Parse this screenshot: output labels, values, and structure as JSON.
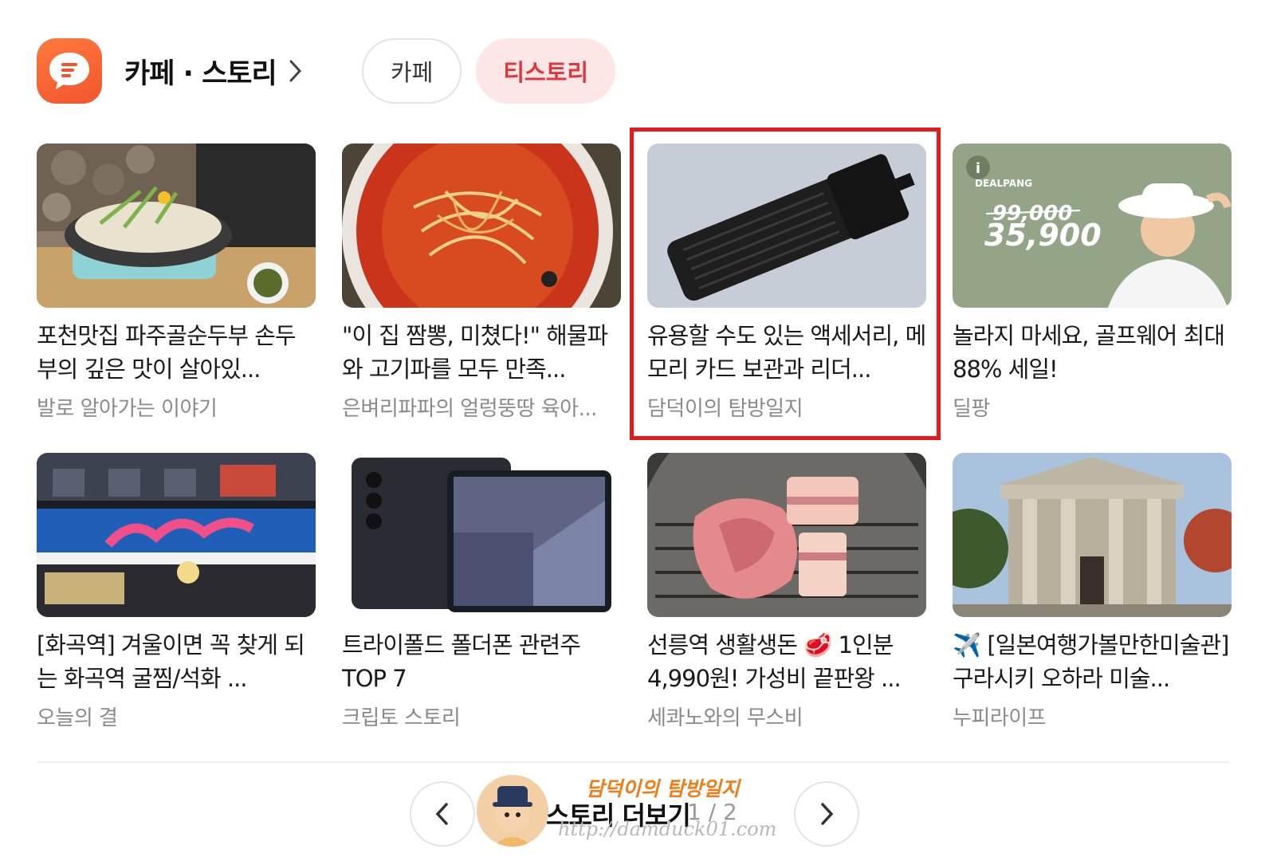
{
  "header": {
    "title": "카페 · 스토리",
    "icon": "chat-bubble-icon",
    "accent": "#f2542d"
  },
  "tabs": [
    {
      "label": "카페",
      "active": false
    },
    {
      "label": "티스토리",
      "active": true
    }
  ],
  "cards": [
    {
      "title": "포천맛집 파주골순두부 손두부의 깊은 맛이 살아있...",
      "source": "발로 알아가는 이야기"
    },
    {
      "title": "\"이 집 짬뽕, 미쳤다!\" 해물파와 고기파를 모두 만족...",
      "source": "은벼리파파의 얼렁뚱땅 육아..."
    },
    {
      "title": "유용할 수도 있는 액세서리, 메모리 카드 보관과 리더...",
      "source": "담덕이의 탐방일지",
      "highlighted": true
    },
    {
      "title": "놀라지 마세요, 골프웨어 최대 88% 세일!",
      "source": "딜팡",
      "ad": {
        "brand": "DEALPANG",
        "old_price": "99,000",
        "new_price": "35,900"
      }
    },
    {
      "title": "[화곡역] 겨울이면 꼭 찾게 되는 화곡역 굴찜/석화 ...",
      "source": "오늘의 결"
    },
    {
      "title": "트라이폴드 폴더폰 관련주 TOP 7",
      "source": "크립토 스토리"
    },
    {
      "title": "선릉역 생활생돈 🥩 1인분 4,990원! 가성비 끝판왕 ...",
      "source": "세콰노와의 무스비"
    },
    {
      "title": "✈️ [일본여행가볼만한미술관] 구라시키 오하라 미술...",
      "source": "누피라이프"
    }
  ],
  "pager": {
    "more_label": "스토리 더보기",
    "current_page": "1",
    "total_pages": "2",
    "page_text": "1 / 2"
  },
  "watermark": {
    "name": "담덕이의 탐방일지",
    "url": "http://damduck01.com"
  },
  "colors": {
    "highlight_box": "#e31b1b",
    "active_tab_bg": "#fde6e6",
    "active_tab_text": "#e0373d"
  }
}
